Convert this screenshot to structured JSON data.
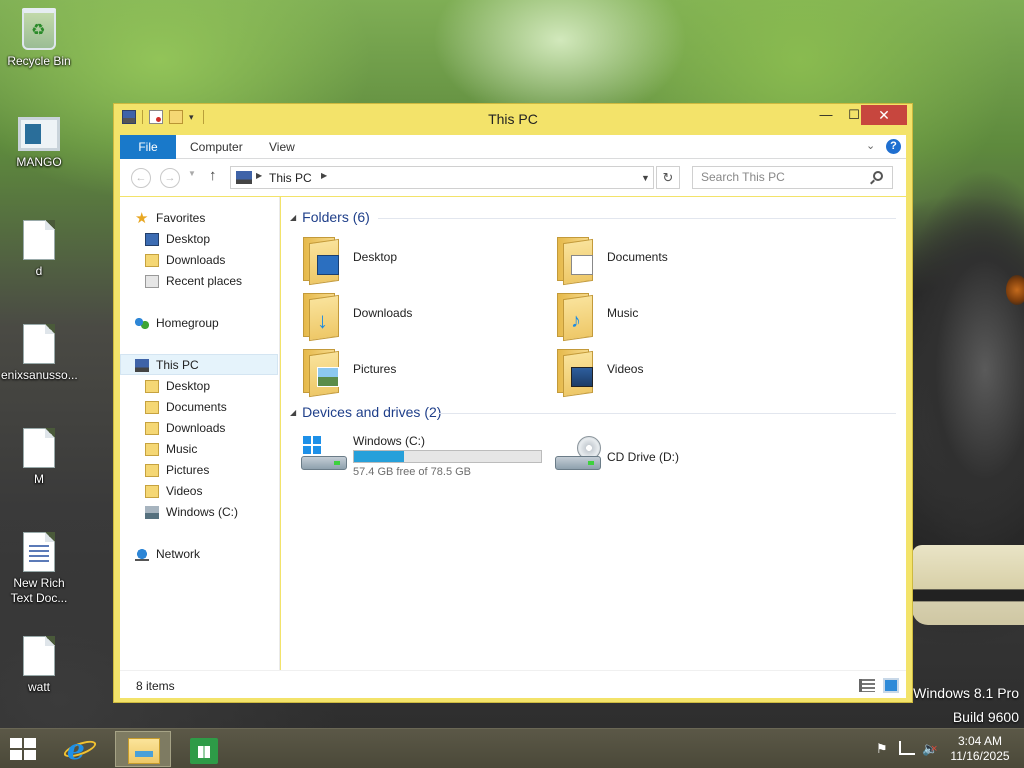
{
  "desktop": {
    "icons": [
      {
        "label": "Recycle Bin"
      },
      {
        "label": "MANGO"
      },
      {
        "label": "d"
      },
      {
        "label": "enixsanusso..."
      },
      {
        "label": "M"
      },
      {
        "label": "New Rich Text Doc..."
      },
      {
        "label": "watt"
      }
    ],
    "watermark": {
      "line1": "Windows 8.1 Pro",
      "line2": "Build 9600"
    }
  },
  "window": {
    "title": "This PC",
    "controls": {
      "minimize": "—",
      "maximize": "☐",
      "close": "✕"
    },
    "ribbon": {
      "tabs": [
        {
          "label": "File"
        },
        {
          "label": "Computer"
        },
        {
          "label": "View"
        }
      ]
    },
    "address": {
      "path": "This PC",
      "search_placeholder": "Search This PC"
    },
    "nav_pane": {
      "favorites_label": "Favorites",
      "favorites": [
        "Desktop",
        "Downloads",
        "Recent places"
      ],
      "homegroup_label": "Homegroup",
      "thispc_label": "This PC",
      "thispc_children": [
        "Desktop",
        "Documents",
        "Downloads",
        "Music",
        "Pictures",
        "Videos",
        "Windows (C:)"
      ],
      "network_label": "Network"
    },
    "main": {
      "folders_header": "Folders (6)",
      "folders": [
        {
          "label": "Desktop",
          "icon": "desktop-folder-icon"
        },
        {
          "label": "Documents",
          "icon": "documents-folder-icon"
        },
        {
          "label": "Downloads",
          "icon": "downloads-folder-icon"
        },
        {
          "label": "Music",
          "icon": "music-folder-icon"
        },
        {
          "label": "Pictures",
          "icon": "pictures-folder-icon"
        },
        {
          "label": "Videos",
          "icon": "videos-folder-icon"
        }
      ],
      "drives_header": "Devices and drives (2)",
      "drives": [
        {
          "label": "Windows (C:)",
          "free_text": "57.4 GB free of 78.5 GB",
          "used_fraction": 0.269
        },
        {
          "label": "CD Drive (D:)"
        }
      ]
    },
    "status": {
      "item_count": "8 items"
    }
  },
  "taskbar": {
    "clock_time": "3:04 AM",
    "clock_date": "11/16/2025"
  },
  "colors": {
    "window_frame": "#f3e36a",
    "file_tab": "#1979ca",
    "close_button": "#c7463e",
    "capacity_fill": "#26a0da",
    "group_header": "#1f3f8a"
  }
}
